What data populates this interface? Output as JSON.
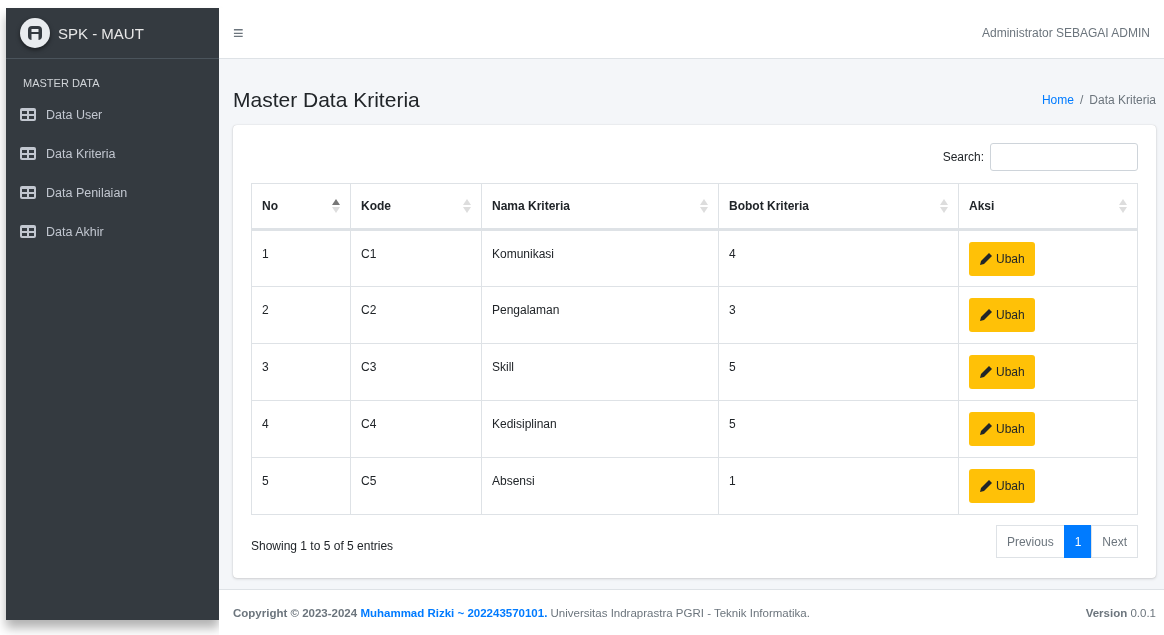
{
  "brand": {
    "title": "SPK - MAUT"
  },
  "sidebar": {
    "section": "MASTER DATA",
    "items": [
      {
        "label": "Data User",
        "selected": false
      },
      {
        "label": "Data Kriteria",
        "selected": false
      },
      {
        "label": "Data Penilaian",
        "selected": false
      },
      {
        "label": "Data Akhir",
        "selected": false
      }
    ]
  },
  "topbar": {
    "menu_icon": "≡",
    "user": "Administrator SEBAGAI ADMIN"
  },
  "page": {
    "title": "Master Data Kriteria",
    "breadcrumb": [
      {
        "label": "Home",
        "link": true
      },
      {
        "label": "Data Kriteria",
        "link": false
      }
    ],
    "breadcrumb_separator": "/"
  },
  "search": {
    "label": "Search:"
  },
  "table": {
    "columns": [
      {
        "label": "No",
        "sorted": true
      },
      {
        "label": "Kode",
        "sorted": false
      },
      {
        "label": "Nama Kriteria",
        "sorted": false
      },
      {
        "label": "Bobot Kriteria",
        "sorted": false
      },
      {
        "label": "Aksi",
        "sorted": false
      }
    ],
    "rows": [
      {
        "no": "1",
        "kode": "C1",
        "nama": "Komunikasi",
        "bobot": "4",
        "action": "Ubah"
      },
      {
        "no": "2",
        "kode": "C2",
        "nama": "Pengalaman",
        "bobot": "3",
        "action": "Ubah"
      },
      {
        "no": "3",
        "kode": "C3",
        "nama": "Skill",
        "bobot": "5",
        "action": "Ubah"
      },
      {
        "no": "4",
        "kode": "C4",
        "nama": "Kedisiplinan",
        "bobot": "5",
        "action": "Ubah"
      },
      {
        "no": "5",
        "kode": "C5",
        "nama": "Absensi",
        "bobot": "1",
        "action": "Ubah"
      }
    ]
  },
  "info": "Showing 1 to 5 of 5 entries",
  "pagination": {
    "previous": "Previous",
    "pages": [
      {
        "label": "1",
        "selected": true
      }
    ],
    "next": "Next"
  },
  "footer": {
    "copyright": "Copyright © 2023-2024",
    "author": "Muhammad Rizki ~ 202243570101.",
    "text": "Universitas Indraprastra PGRI - Teknik Informatika.",
    "version": "**Version** 0.0.1"
  }
}
